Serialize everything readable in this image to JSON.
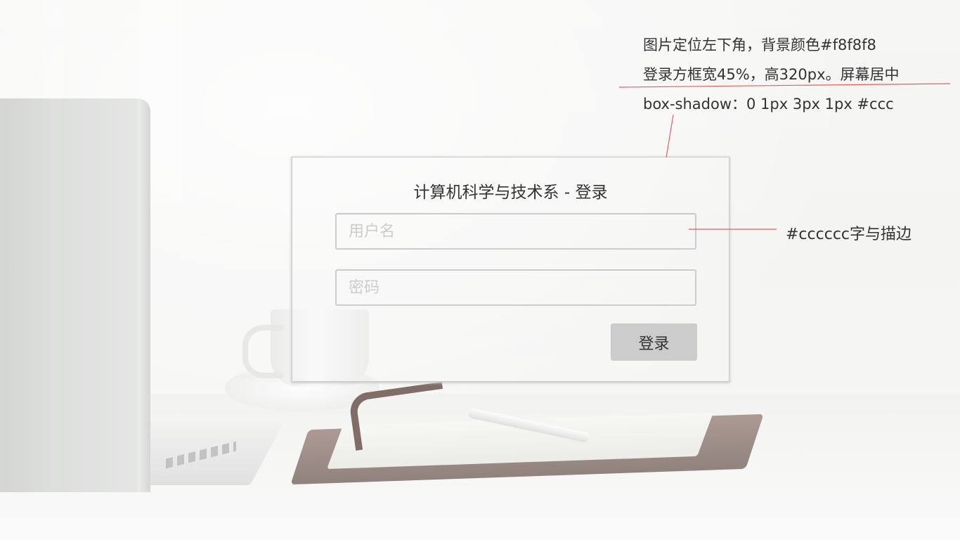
{
  "login": {
    "title": "计算机科学与技术系 - 登录",
    "username_placeholder": "用户名",
    "username_value": "",
    "password_placeholder": "密码",
    "password_value": "",
    "submit_label": "登录"
  },
  "annotations": {
    "note_background": "图片定位左下角，背景颜色#f8f8f8",
    "note_box": "登录方框宽45%，高320px。屏幕居中",
    "note_shadow": "box-shadow：0 1px 3px 1px #ccc",
    "note_stroke": "#cccccc字与描边"
  },
  "colors": {
    "page_background": "#f8f8f8",
    "field_text_and_border": "#cccccc",
    "button_background": "#cccccc",
    "annotation_line": "#e06060",
    "title_text": "#333333"
  }
}
